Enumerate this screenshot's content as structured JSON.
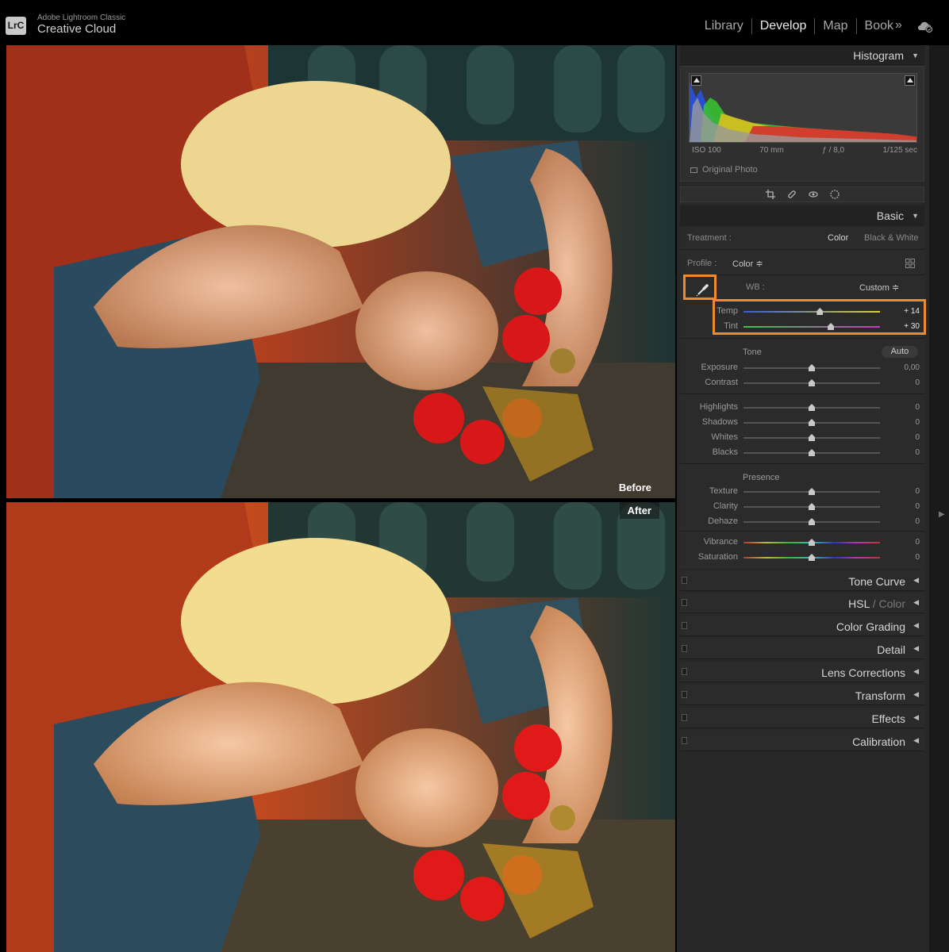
{
  "app": {
    "logo_text": "LrC",
    "brand_small": "Adobe Lightroom Classic",
    "brand_main": "Creative Cloud"
  },
  "modules": [
    "Library",
    "Develop",
    "Map",
    "Book"
  ],
  "active_module": "Develop",
  "photo": {
    "before_label": "Before",
    "after_label": "After"
  },
  "histogram": {
    "title": "Histogram",
    "iso": "ISO 100",
    "focal": "70 mm",
    "aperture": "ƒ / 8,0",
    "shutter": "1/125 sec",
    "original_photo": "Original Photo"
  },
  "basic": {
    "title": "Basic",
    "treatment_label": "Treatment :",
    "treatment_color": "Color",
    "treatment_bw": "Black & White",
    "profile_label": "Profile :",
    "profile_value": "Color ≑",
    "wb_label": "WB :",
    "wb_value": "Custom ≑",
    "temp": {
      "label": "Temp",
      "value": "+ 14",
      "level": 0.56
    },
    "tint": {
      "label": "Tint",
      "value": "+ 30",
      "level": 0.64
    },
    "tone_title": "Tone",
    "auto_label": "Auto",
    "exposure": {
      "label": "Exposure",
      "value": "0,00",
      "level": 0.5
    },
    "contrast": {
      "label": "Contrast",
      "value": "0",
      "level": 0.5
    },
    "highlights": {
      "label": "Highlights",
      "value": "0",
      "level": 0.5
    },
    "shadows": {
      "label": "Shadows",
      "value": "0",
      "level": 0.5
    },
    "whites": {
      "label": "Whites",
      "value": "0",
      "level": 0.5
    },
    "blacks": {
      "label": "Blacks",
      "value": "0",
      "level": 0.5
    },
    "presence_title": "Presence",
    "texture": {
      "label": "Texture",
      "value": "0",
      "level": 0.5
    },
    "clarity": {
      "label": "Clarity",
      "value": "0",
      "level": 0.5
    },
    "dehaze": {
      "label": "Dehaze",
      "value": "0",
      "level": 0.5
    },
    "vibrance": {
      "label": "Vibrance",
      "value": "0",
      "level": 0.5
    },
    "saturation": {
      "label": "Saturation",
      "value": "0",
      "level": 0.5
    }
  },
  "sections": {
    "tone_curve": "Tone Curve",
    "hsl": "HSL",
    "hsl_sep": " / ",
    "hsl_color": "Color",
    "color_grading": "Color Grading",
    "detail": "Detail",
    "lens_corrections": "Lens Corrections",
    "transform": "Transform",
    "effects": "Effects",
    "calibration": "Calibration"
  },
  "colors": {
    "highlight": "#f08a2a",
    "panel_bg": "#282828"
  },
  "icons": [
    "lrc-logo-icon",
    "more-modules-icon",
    "cloud-sync-icon",
    "crop-icon",
    "spot-heal-icon",
    "red-eye-icon",
    "mask-icon",
    "eyedropper-icon"
  ]
}
